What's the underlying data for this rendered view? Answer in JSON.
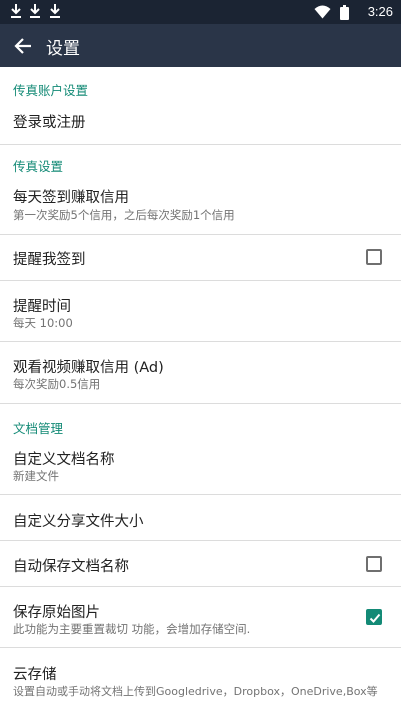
{
  "status_bar": {
    "time": "3:26",
    "icons": [
      "download-icon",
      "download-icon",
      "download-icon",
      "wifi-icon",
      "battery-icon"
    ]
  },
  "toolbar": {
    "back_icon": "arrow-left-icon",
    "title": "设置"
  },
  "sections": {
    "fax_account": "传真账户设置",
    "fax_settings": "传真设置",
    "doc_management": "文档管理"
  },
  "items": {
    "login": {
      "title": "登录或注册"
    },
    "daily_checkin": {
      "title": "每天签到赚取信用",
      "subtitle": "第一次奖励5个信用，之后每次奖励1个信用"
    },
    "remind_checkin": {
      "title": "提醒我签到",
      "checked": false
    },
    "remind_time": {
      "title": "提醒时间",
      "subtitle": "每天 10:00"
    },
    "watch_video": {
      "title": "观看视频赚取信用 (Ad)",
      "subtitle": "每次奖励0.5信用"
    },
    "custom_doc_name": {
      "title": "自定义文档名称",
      "subtitle": "新建文件"
    },
    "custom_share_size": {
      "title": "自定义分享文件大小"
    },
    "autosave_doc_name": {
      "title": "自动保存文档名称",
      "checked": false
    },
    "save_original": {
      "title": "保存原始图片",
      "subtitle": "此功能为主要重置裁切 功能，会增加存储空间.",
      "checked": true
    },
    "cloud_storage": {
      "title": "云存储",
      "subtitle": "设置自动或手动将文档上传到Googledrive，Dropbox，OneDrive,Box等"
    }
  },
  "colors": {
    "status_bar": "#1b2433",
    "toolbar": "#2a3548",
    "accent": "#138a76",
    "divider": "#dcdcdc"
  }
}
